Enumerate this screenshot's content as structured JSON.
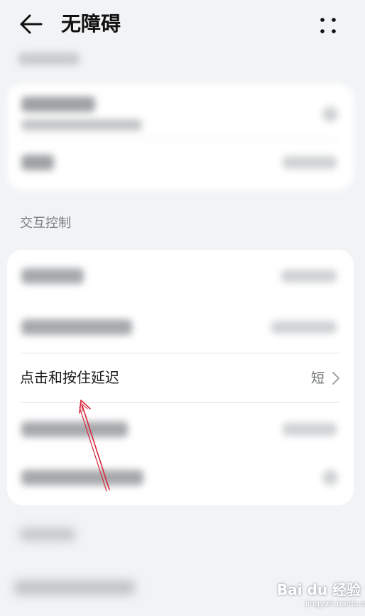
{
  "header": {
    "title": "无障碍"
  },
  "interaction_section": {
    "label": "交互控制",
    "focused_row": {
      "label": "点击和按住延迟",
      "value": "短"
    }
  },
  "watermark": {
    "brand": "Bai du 经验",
    "url": "jingyan.baidu.com"
  }
}
